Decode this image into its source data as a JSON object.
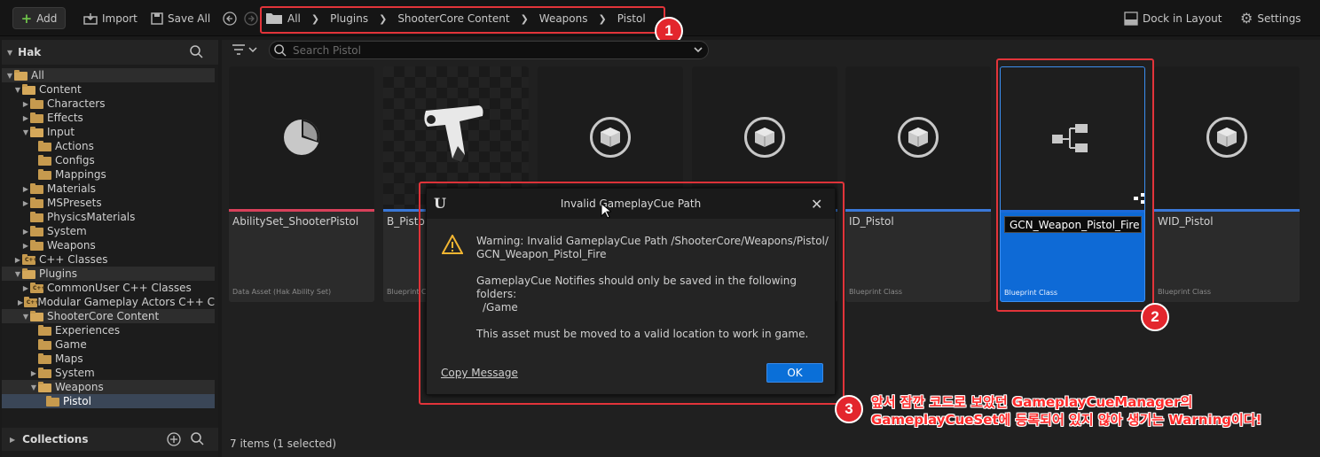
{
  "toolbar": {
    "add_label": "Add",
    "import_label": "Import",
    "saveall_label": "Save All",
    "dock_label": "Dock in Layout",
    "settings_label": "Settings"
  },
  "breadcrumb": [
    "All",
    "Plugins",
    "ShooterCore Content",
    "Weapons",
    "Pistol"
  ],
  "left_panel": {
    "title": "Hak",
    "collections_label": "Collections",
    "tree": [
      {
        "label": "All",
        "depth": 0,
        "open": true,
        "state": "hl"
      },
      {
        "label": "Content",
        "depth": 1,
        "open": true
      },
      {
        "label": "Characters",
        "depth": 2,
        "arrow": true
      },
      {
        "label": "Effects",
        "depth": 2,
        "arrow": true
      },
      {
        "label": "Input",
        "depth": 2,
        "open": true
      },
      {
        "label": "Actions",
        "depth": 3
      },
      {
        "label": "Configs",
        "depth": 3
      },
      {
        "label": "Mappings",
        "depth": 3
      },
      {
        "label": "Materials",
        "depth": 2,
        "arrow": true
      },
      {
        "label": "MSPresets",
        "depth": 2,
        "arrow": true
      },
      {
        "label": "PhysicsMaterials",
        "depth": 2
      },
      {
        "label": "System",
        "depth": 2,
        "arrow": true
      },
      {
        "label": "Weapons",
        "depth": 2,
        "arrow": true
      },
      {
        "label": "C++ Classes",
        "depth": 1,
        "arrow": true,
        "cpp": true
      },
      {
        "label": "Plugins",
        "depth": 1,
        "open": true,
        "state": "hl"
      },
      {
        "label": "CommonUser C++ Classes",
        "depth": 2,
        "arrow": true,
        "cpp": true
      },
      {
        "label": "Modular Gameplay Actors C++ C",
        "depth": 2,
        "arrow": true,
        "cpp": true
      },
      {
        "label": "ShooterCore Content",
        "depth": 2,
        "open": true,
        "state": "hl"
      },
      {
        "label": "Experiences",
        "depth": 3
      },
      {
        "label": "Game",
        "depth": 3
      },
      {
        "label": "Maps",
        "depth": 3
      },
      {
        "label": "System",
        "depth": 3,
        "arrow": true
      },
      {
        "label": "Weapons",
        "depth": 3,
        "open": true,
        "state": "hl"
      },
      {
        "label": "Pistol",
        "depth": 4,
        "state": "sel"
      }
    ]
  },
  "search": {
    "placeholder": "Search Pistol"
  },
  "assets": [
    {
      "name": "AbilitySet_ShooterPistol",
      "type": "Data Asset (Hak Ability Set)",
      "stripe": "#d9405a",
      "thumb": "pie"
    },
    {
      "name": "B_Pistol",
      "type": "Blueprint C",
      "stripe": "#3a78d8",
      "thumb": "gun"
    },
    {
      "name": "",
      "type": "",
      "stripe": "#3a78d8",
      "thumb": "cube"
    },
    {
      "name": "",
      "type": "",
      "stripe": "#3a78d8",
      "thumb": "cube"
    },
    {
      "name": "ID_Pistol",
      "type": "Blueprint Class",
      "stripe": "#3a78d8",
      "thumb": "cube"
    },
    {
      "name": "GCN_Weapon_Pistol_Fire",
      "type": "Blueprint Class",
      "stripe": "#1c6ad8",
      "thumb": "tree",
      "selected": true
    },
    {
      "name": "WID_Pistol",
      "type": "Blueprint Class",
      "stripe": "#3a78d8",
      "thumb": "cube"
    }
  ],
  "dialog": {
    "title": "Invalid GameplayCue Path",
    "warning_line1": "Warning: Invalid GameplayCue Path /ShooterCore/Weapons/Pistol/",
    "warning_line2": "GCN_Weapon_Pistol_Fire",
    "folders_line1": "GameplayCue Notifies should only be saved in the following folders:",
    "folders_line2": "/Game",
    "move_line": "This asset must be moved to a valid location to work in game.",
    "copy_label": "Copy Message",
    "ok_label": "OK"
  },
  "annotations": {
    "badge1": "1",
    "badge2": "2",
    "badge3": "3",
    "note_line1": "앞서 잠깐 코드로 보았던 GameplayCueManager의",
    "note_line2": "GameplayCueSet에 등록되어 있지 않아 생기는 Warning이다!"
  },
  "status": "7 items (1 selected)",
  "colors": {
    "accent": "#0a6fd8",
    "annotation": "#e3262d",
    "folder": "#c69a4e"
  }
}
